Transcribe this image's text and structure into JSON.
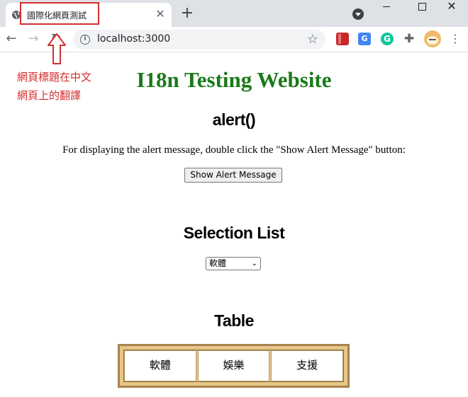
{
  "browser": {
    "tab": {
      "title": "國際化網頁測試"
    },
    "address_bar": {
      "url": "localhost:3000"
    },
    "extensions": {
      "translate_label": "G",
      "grammarly_label": "G"
    }
  },
  "annotation": {
    "lines": [
      "網頁標題在中文",
      "網頁上的翻譯"
    ],
    "color": "#d32f2f"
  },
  "page": {
    "title": "I18n Testing Website",
    "title_color": "#1a7a1a",
    "alert_section": {
      "heading": "alert()",
      "instruction": "For displaying the alert message, double click the \"Show Alert Message\" button:",
      "button_label": "Show Alert Message"
    },
    "selection_section": {
      "heading": "Selection List",
      "selected_value": "軟體"
    },
    "table_section": {
      "heading": "Table",
      "cells": [
        "軟體",
        "娛樂",
        "支援"
      ],
      "border_color": "#a7834d",
      "fill_color": "#e6c789"
    }
  }
}
